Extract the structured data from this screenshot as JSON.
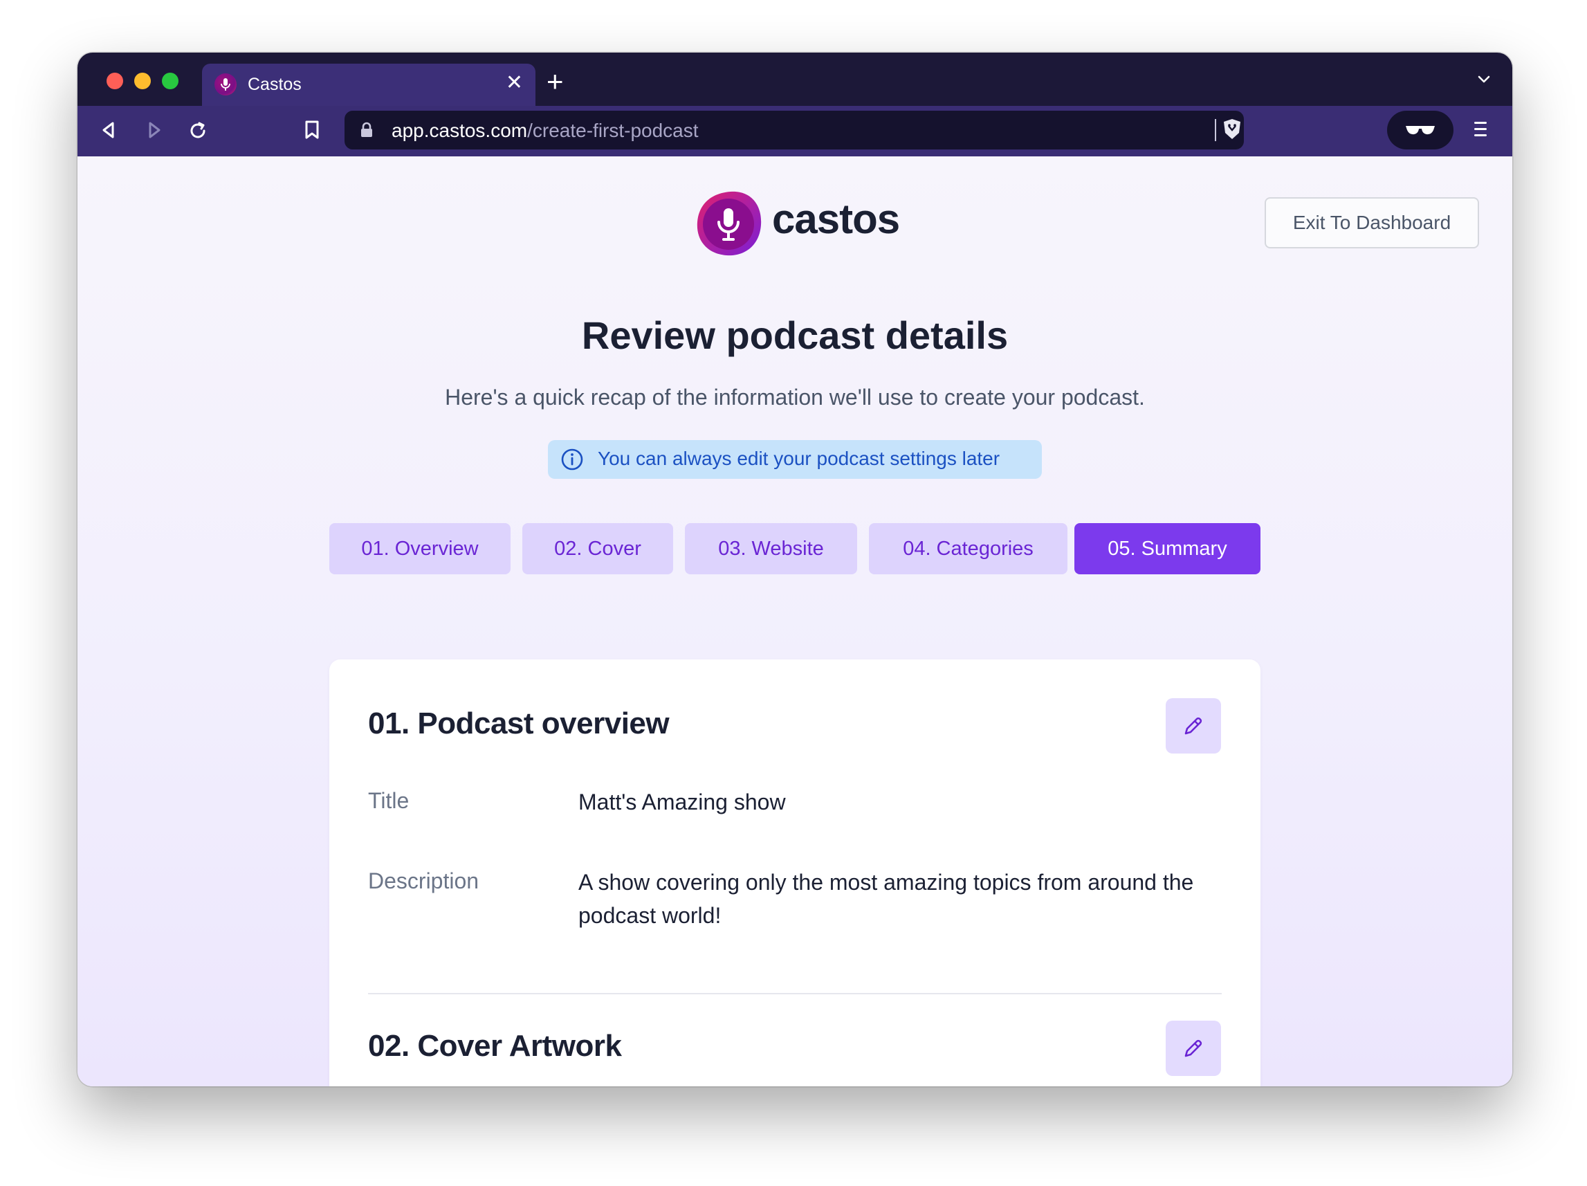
{
  "browser": {
    "tab_title": "Castos",
    "url_domain": "app.castos.com",
    "url_path": "/create-first-podcast"
  },
  "header": {
    "logo_text": "castos",
    "exit_label": "Exit To Dashboard"
  },
  "page": {
    "title": "Review podcast details",
    "subtitle": "Here's a quick recap of the information we'll use to create your podcast.",
    "info": "You can always edit your podcast settings later"
  },
  "steps": [
    {
      "label": "01. Overview",
      "active": false
    },
    {
      "label": "02. Cover",
      "active": false
    },
    {
      "label": "03. Website",
      "active": false
    },
    {
      "label": "04. Categories",
      "active": false
    },
    {
      "label": "05. Summary",
      "active": true
    }
  ],
  "overview": {
    "title": "01. Podcast overview",
    "title_label": "Title",
    "title_value": "Matt's Amazing show",
    "description_label": "Description",
    "description_value": "A show covering only the most amazing topics from around the podcast world!"
  },
  "cover": {
    "title": "02. Cover Artwork"
  },
  "colors": {
    "accent": "#7c3aed",
    "step_inactive_bg": "#ddd3fd",
    "info_bg": "#c6e3fb",
    "info_text": "#1b51c2"
  }
}
